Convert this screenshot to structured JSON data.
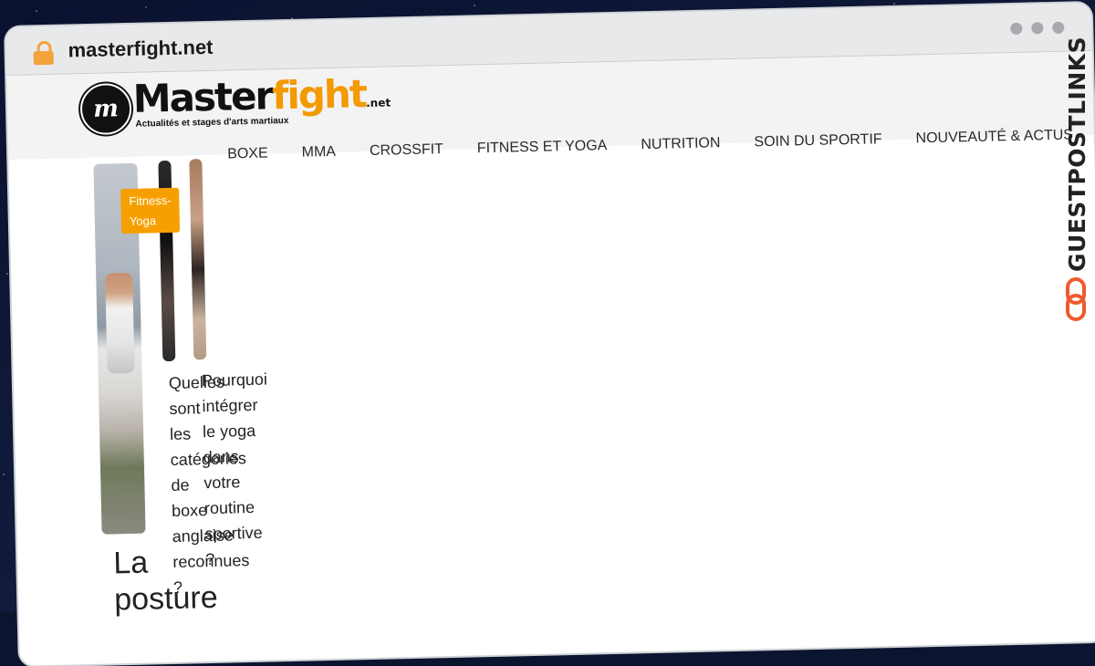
{
  "browser": {
    "url": "masterfight.net"
  },
  "site": {
    "logo_initial": "m",
    "logo_word_black": "Master",
    "logo_word_orange": "fight",
    "logo_tld": ".net",
    "tagline": "Actualités et stages d'arts martiaux",
    "nav": [
      "BOXE",
      "MMA",
      "CROSSFIT",
      "FITNESS ET YOGA",
      "NUTRITION",
      "SOIN DU SPORTIF",
      "NOUVEAUTÉ & ACTUS"
    ]
  },
  "articles": {
    "badge": "Fitness-Yoga",
    "teaser1": "Quelles sont les catégories de boxe anglaise reconnues ?",
    "teaser2": "Pourquoi intégrer le yoga dans votre routine sportive ?",
    "headline": "La posture"
  },
  "watermark": {
    "text": "GUESTPOSTLINKS"
  }
}
